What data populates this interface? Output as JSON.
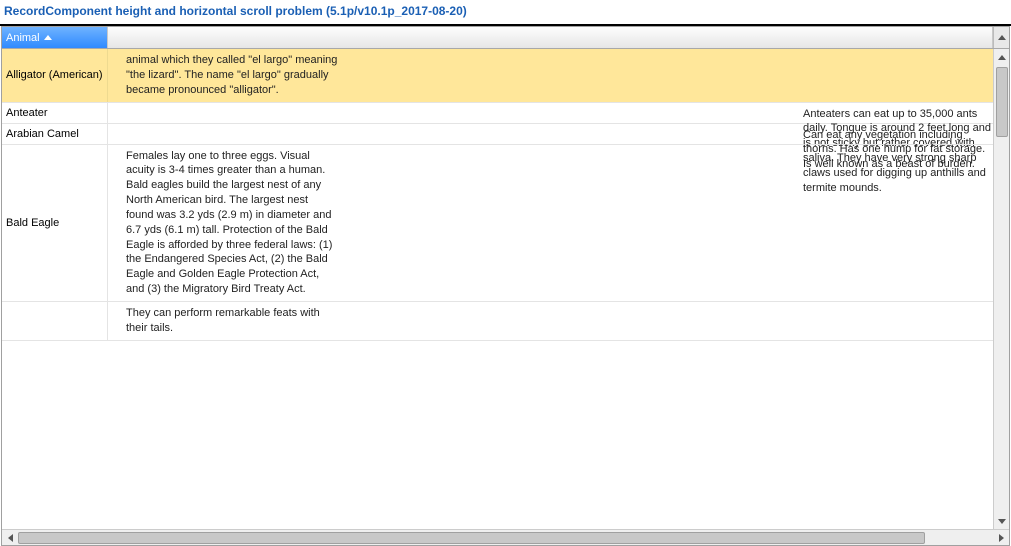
{
  "title": "RecordComponent height and horizontal scroll problem (5.1p/v10.1p_2017-08-20)",
  "header": {
    "column": "Animal"
  },
  "rows": [
    {
      "name": "Alligator (American)",
      "selected": true,
      "desc_pos": "left",
      "desc": "animal which they called \"el largo\" meaning \"the lizard\". The name \"el largo\" gradually became pronounced \"alligator\"."
    },
    {
      "name": "Anteater",
      "selected": false,
      "desc_pos": "right",
      "desc": "Anteaters can eat up to 35,000 ants daily. Tongue is around 2 feet long and is not sticky but rather covered with saliva. They have very strong sharp claws used for digging up anthills and termite mounds."
    },
    {
      "name": "Arabian Camel",
      "selected": false,
      "desc_pos": "right",
      "desc": "Can eat any vegetation including thorns. Has one hump for fat storage. Is well known as a beast of burden."
    },
    {
      "name": "Bald Eagle",
      "selected": false,
      "desc_pos": "left",
      "desc": "Females lay one to three eggs. Visual acuity is 3-4 times greater than a human. Bald eagles build the largest nest of any North American bird. The largest nest found was 3.2 yds (2.9 m) in diameter and 6.7 yds (6.1 m) tall. Protection of the Bald Eagle is afforded by three federal laws: (1) the Endangered Species Act, (2) the Bald Eagle and Golden Eagle Protection Act, and (3) the Migratory Bird Treaty Act."
    },
    {
      "name": "",
      "selected": false,
      "desc_pos": "left",
      "desc": "They can perform remarkable feats with their tails."
    }
  ]
}
